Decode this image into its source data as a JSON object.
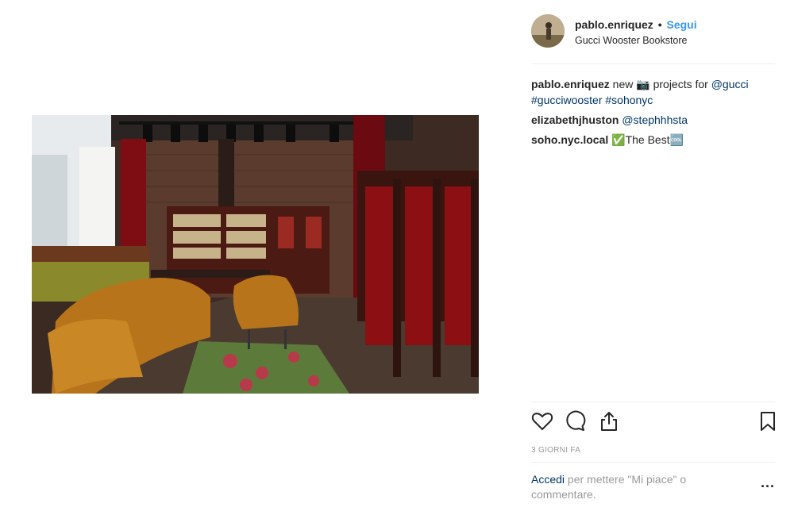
{
  "post": {
    "username": "pablo.enriquez",
    "separator": "•",
    "follow_label": "Segui",
    "location": "Gucci Wooster Bookstore",
    "image_subject": "Gucci Wooster Bookstore interior"
  },
  "comments": [
    {
      "user": "pablo.enriquez",
      "text_a": " new 📷 projects for ",
      "tags": "@gucci #gucciwooster #sohonyc"
    },
    {
      "user": "elizabethjhuston",
      "text_a": " ",
      "tags": "@stephhhsta"
    },
    {
      "user": "soho.nyc.local",
      "text_a": " ✅The Best🆒",
      "tags": ""
    }
  ],
  "actions": {
    "like_icon": "heart-icon",
    "comment_icon": "comment-icon",
    "share_icon": "share-icon",
    "save_icon": "bookmark-icon"
  },
  "timestamp": "3 GIORNI FA",
  "login_prompt": {
    "link_label": "Accedi",
    "text": " per mettere \"Mi piace\" o commentare.",
    "more_label": "..."
  },
  "colors": {
    "accent": "#3897f0",
    "link": "#003569",
    "muted": "#999999",
    "divider": "#efefef"
  }
}
